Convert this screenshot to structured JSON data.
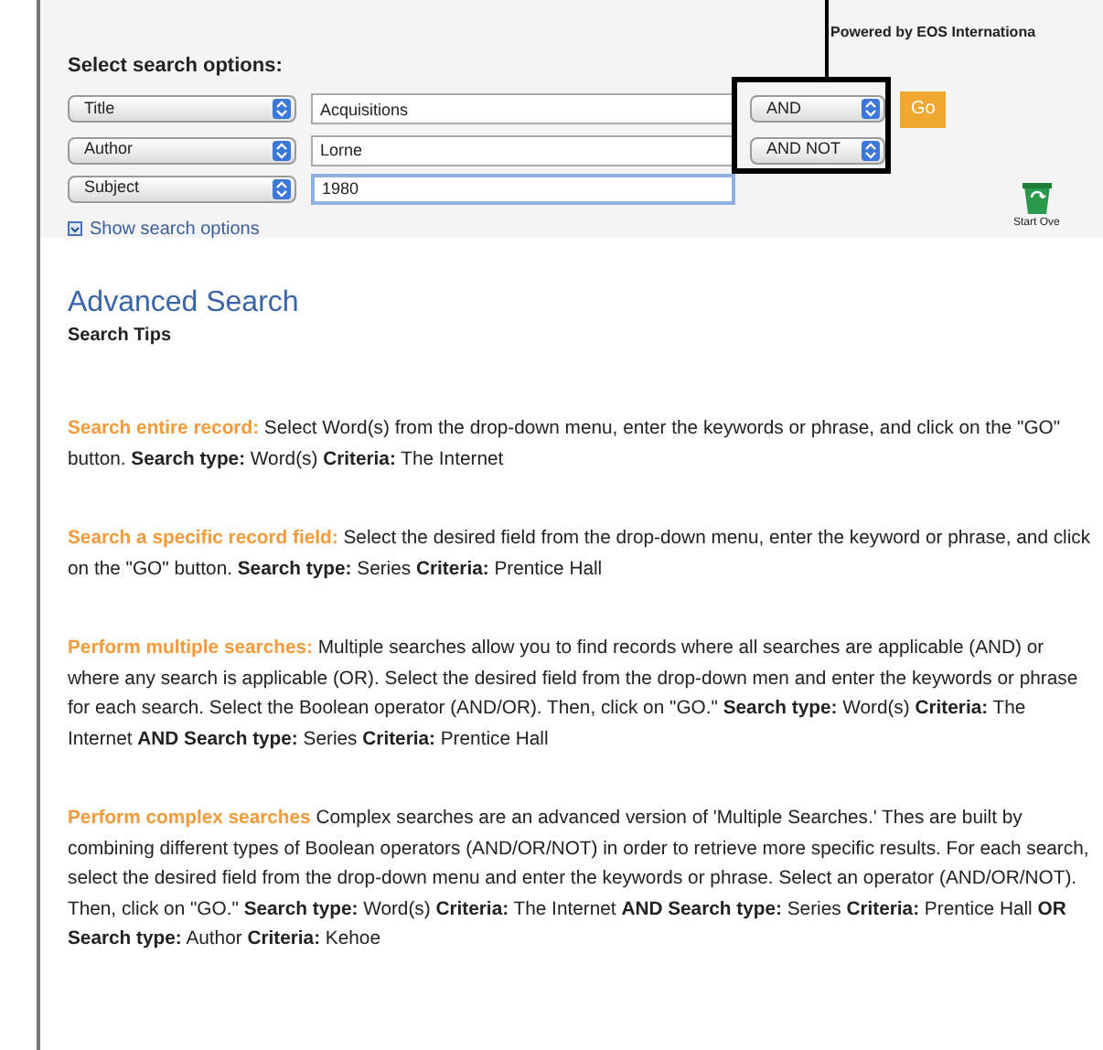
{
  "header": {
    "powered_by": "Powered by EOS Internationa"
  },
  "search_form": {
    "title": "Select search options:",
    "rows": [
      {
        "field": "Title",
        "query": "Acquisitions",
        "operator": "AND",
        "focused": false
      },
      {
        "field": "Author",
        "query": "Lorne",
        "operator": "AND NOT",
        "focused": false
      },
      {
        "field": "Subject",
        "query": "1980",
        "focused": true
      }
    ],
    "go_button": "Go",
    "show_options": "Show search options",
    "start_over": "Start Ove"
  },
  "heading": "Advanced Search",
  "subheading": "Search Tips",
  "tips": [
    {
      "title": "Search entire record:",
      "text": "Select Word(s) from the drop-down menu, enter the keywords or phrase, and click on the \"GO\" button. **Search type:** Word(s) **Criteria:** The Internet"
    },
    {
      "title": "Search a specific record field:",
      "text": "Select the desired field from the drop-down menu, enter the keyword or phrase, and click on the \"GO\" button. **Search type:** Series **Criteria:** Prentice Hall"
    },
    {
      "title": "Perform multiple searches:",
      "text": "Multiple searches allow you to find records where all searches are applicable (AND) or where any search is applicable (OR). Select the desired field from the drop-down men and enter the keywords or phrase for each search. Select the Boolean operator (AND/OR). Then, click on \"GO.\" **Search type:** Word(s) **Criteria:** The Internet **AND Search type:** Series **Criteria:** Prentice Hall"
    },
    {
      "title": "Perform complex searches",
      "text": "Complex searches are an advanced version of 'Multiple Searches.' Thes are built by combining different types of Boolean operators (AND/OR/NOT) in order to retrieve more specific results. For each search, select the desired field from the drop-down menu and enter the keywords or phrase. Select an operator (AND/OR/NOT). Then, click on \"GO.\" **Search type:** Word(s) **Criteria:** The Internet **AND Search type:** Series **Criteria:** Prentice Hall **OR Search type:** Author **Criteria:** Kehoe"
    }
  ]
}
